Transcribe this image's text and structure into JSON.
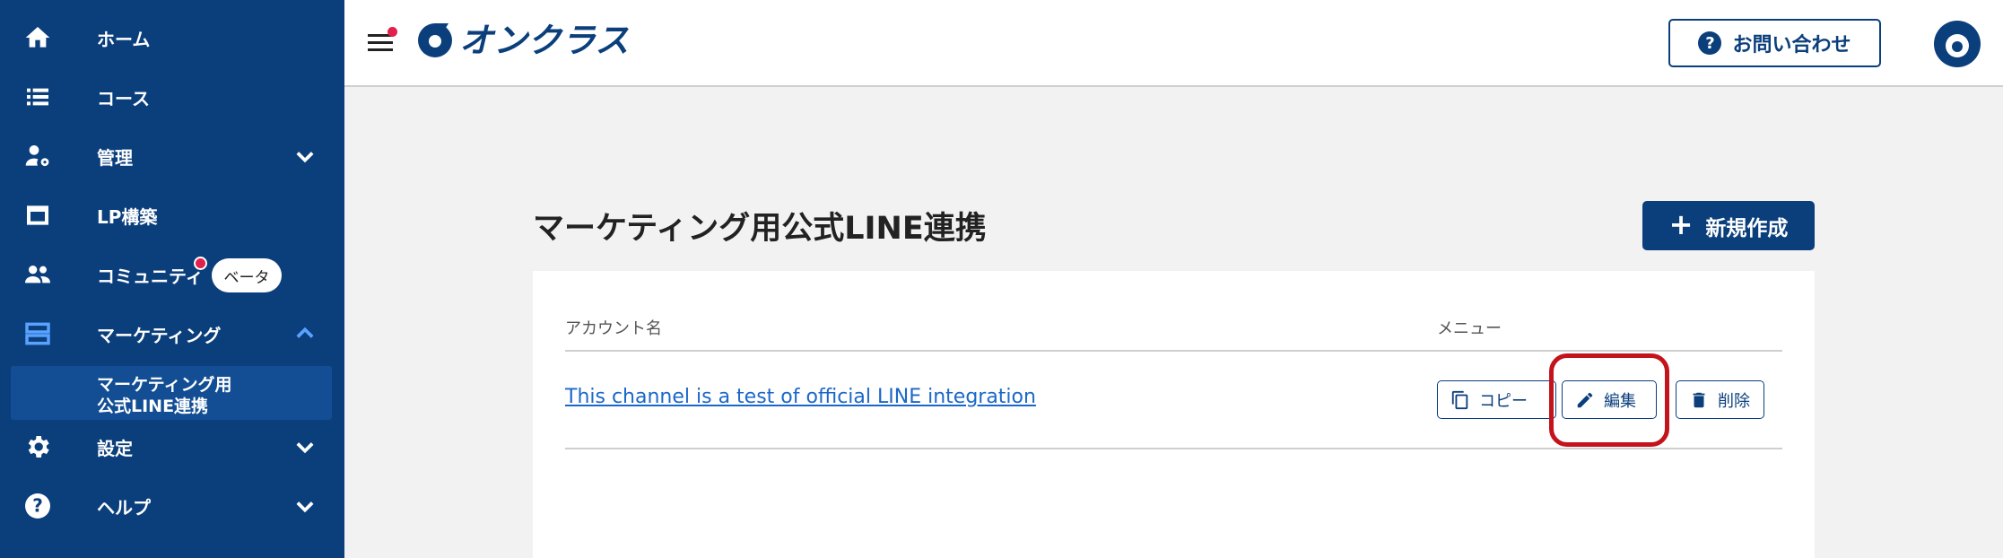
{
  "app": {
    "logo_text": "オンクラス"
  },
  "sidebar": {
    "items": [
      {
        "label": "ホーム",
        "icon": "home-icon"
      },
      {
        "label": "コース",
        "icon": "list-icon"
      },
      {
        "label": "管理",
        "icon": "user-gear-icon"
      },
      {
        "label": "LP構築",
        "icon": "window-icon"
      },
      {
        "label": "コミュニティ",
        "icon": "people-icon",
        "badge": "ベータ"
      },
      {
        "label": "マーケティング",
        "icon": "marketing-icon"
      },
      {
        "label": "設定",
        "icon": "gear-icon"
      },
      {
        "label": "ヘルプ",
        "icon": "help-icon"
      }
    ],
    "sub_item": {
      "line1": "マーケティング用",
      "line2": "公式LINE連携"
    }
  },
  "header": {
    "contact_label": "お問い合わせ"
  },
  "page": {
    "title": "マーケティング用公式LINE連携",
    "new_button": "新規作成",
    "table": {
      "col_account": "アカウント名",
      "col_menu": "メニュー",
      "rows": [
        {
          "account": "This channel is a test of official LINE integration"
        }
      ]
    },
    "actions": {
      "copy": "コピー",
      "edit": "編集",
      "delete": "削除"
    }
  },
  "colors": {
    "sidebar": "#0b3f7c",
    "accent": "#5aa2ff",
    "highlight": "#c3131c",
    "link": "#1b67c9"
  }
}
